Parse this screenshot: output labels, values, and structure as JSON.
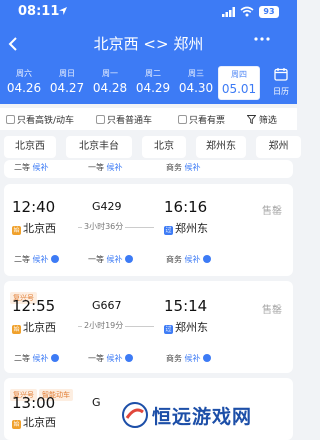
{
  "status_bar": {
    "time": "08:11",
    "battery": "93"
  },
  "nav": {
    "title": "北京西 <> 郑州"
  },
  "dates": [
    {
      "weekday": "周六",
      "date": "04.26"
    },
    {
      "weekday": "周日",
      "date": "04.27"
    },
    {
      "weekday": "周一",
      "date": "04.28"
    },
    {
      "weekday": "周二",
      "date": "04.29"
    },
    {
      "weekday": "周三",
      "date": "04.30"
    },
    {
      "weekday": "周四",
      "date": "05.01",
      "selected": true
    }
  ],
  "calendar_label": "日历",
  "filters": {
    "high_speed": "只看高铁/动车",
    "normal": "只看普通车",
    "available": "只看有票",
    "filter": "筛选"
  },
  "stations": [
    "北京西",
    "北京丰台",
    "北京",
    "郑州东",
    "郑州"
  ],
  "seat_labels": {
    "second": "二等",
    "first": "一等",
    "business": "商务",
    "waitlist": "候补"
  },
  "trains": [
    {
      "tags": [],
      "dep_time": "12:40",
      "dep_station": "北京西",
      "dep_badge": "始",
      "train_no": "G429",
      "duration": "3小时36分",
      "arr_time": "16:16",
      "arr_station": "郑州东",
      "arr_badge": "过",
      "status": "售罄"
    },
    {
      "tags": [
        "复兴号"
      ],
      "dep_time": "12:55",
      "dep_station": "北京西",
      "dep_badge": "始",
      "train_no": "G667",
      "duration": "2小时19分",
      "arr_time": "15:14",
      "arr_station": "郑州东",
      "arr_badge": "过",
      "status": "售罄"
    },
    {
      "tags": [
        "复兴号",
        "智能动车"
      ],
      "dep_time": "13:00",
      "dep_station": "北京西",
      "dep_badge": "始",
      "train_no": "G",
      "duration": "",
      "arr_time": "",
      "arr_station": "",
      "arr_badge": "",
      "status": ""
    }
  ],
  "watermark": {
    "text": "恒远游戏网"
  }
}
